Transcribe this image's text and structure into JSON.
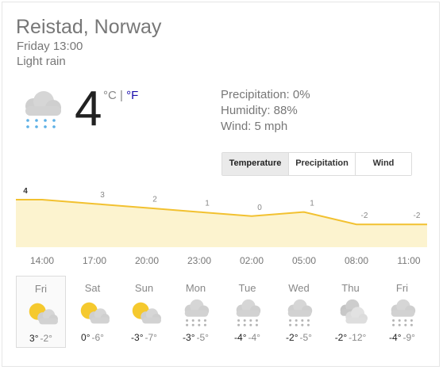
{
  "header": {
    "location": "Reistad, Norway",
    "time": "Friday 13:00",
    "condition": "Light rain"
  },
  "current": {
    "temp": "4",
    "unit_c": "°C",
    "separator": "|",
    "unit_f": "°F",
    "icon": "rain-cloud-icon",
    "precipitation": "Precipitation: 0%",
    "humidity": "Humidity: 88%",
    "wind": "Wind: 5 mph"
  },
  "tabs": [
    {
      "label": "Temperature",
      "active": true
    },
    {
      "label": "Precipitation",
      "active": false
    },
    {
      "label": "Wind",
      "active": false
    }
  ],
  "chart_data": {
    "type": "area",
    "x": [
      "14:00",
      "17:00",
      "20:00",
      "23:00",
      "02:00",
      "05:00",
      "08:00",
      "11:00"
    ],
    "values": [
      4,
      3,
      2,
      1,
      0,
      1,
      -2,
      -2
    ],
    "labels": [
      "4",
      "3",
      "2",
      "1",
      "0",
      "1",
      "-2",
      "-2"
    ],
    "line_color": "#f2c130",
    "fill_color": "#fcf3cf",
    "title": "",
    "xlabel": "",
    "ylabel": ""
  },
  "forecast": [
    {
      "day": "Fri",
      "hi": "3°",
      "lo": "-2°",
      "icon": "partly-cloudy-icon",
      "selected": true
    },
    {
      "day": "Sat",
      "hi": "0°",
      "lo": "-6°",
      "icon": "partly-cloudy-icon"
    },
    {
      "day": "Sun",
      "hi": "-3°",
      "lo": "-7°",
      "icon": "partly-cloudy-icon"
    },
    {
      "day": "Mon",
      "hi": "-3°",
      "lo": "-5°",
      "icon": "snow-icon"
    },
    {
      "day": "Tue",
      "hi": "-4°",
      "lo": "-4°",
      "icon": "snow-icon"
    },
    {
      "day": "Wed",
      "hi": "-2°",
      "lo": "-5°",
      "icon": "snow-icon"
    },
    {
      "day": "Thu",
      "hi": "-2°",
      "lo": "-12°",
      "icon": "cloudy-icon"
    },
    {
      "day": "Fri",
      "hi": "-4°",
      "lo": "-9°",
      "icon": "snow-icon"
    }
  ]
}
